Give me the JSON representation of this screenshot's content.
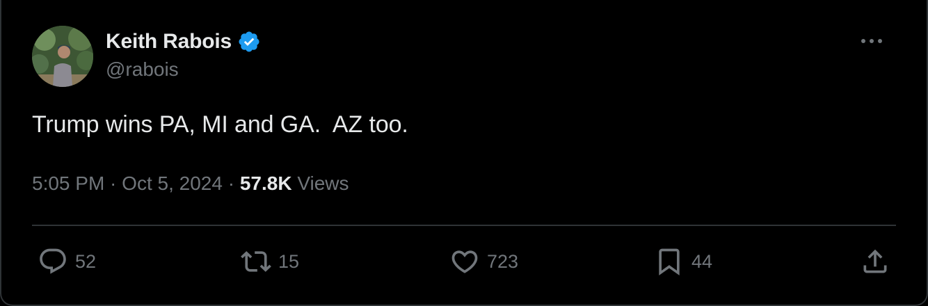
{
  "author": {
    "display_name": "Keith Rabois",
    "handle": "@rabois",
    "verified_color": "#1d9bf0"
  },
  "tweet": {
    "text": "Trump wins PA, MI and GA.  AZ too."
  },
  "meta": {
    "time": "5:05 PM",
    "separator_1": " · ",
    "date": "Oct 5, 2024",
    "separator_2": " · ",
    "views_count": "57.8K",
    "views_label": " Views"
  },
  "actions": {
    "reply": {
      "icon": "reply-icon",
      "count": "52"
    },
    "retweet": {
      "icon": "retweet-icon",
      "count": "15"
    },
    "like": {
      "icon": "heart-icon",
      "count": "723"
    },
    "bookmark": {
      "icon": "bookmark-icon",
      "count": "44"
    },
    "share": {
      "icon": "share-icon"
    }
  },
  "colors": {
    "background": "#000000",
    "primary_text": "#e7e9ea",
    "secondary_text": "#71767b",
    "divider": "#2f3336"
  }
}
